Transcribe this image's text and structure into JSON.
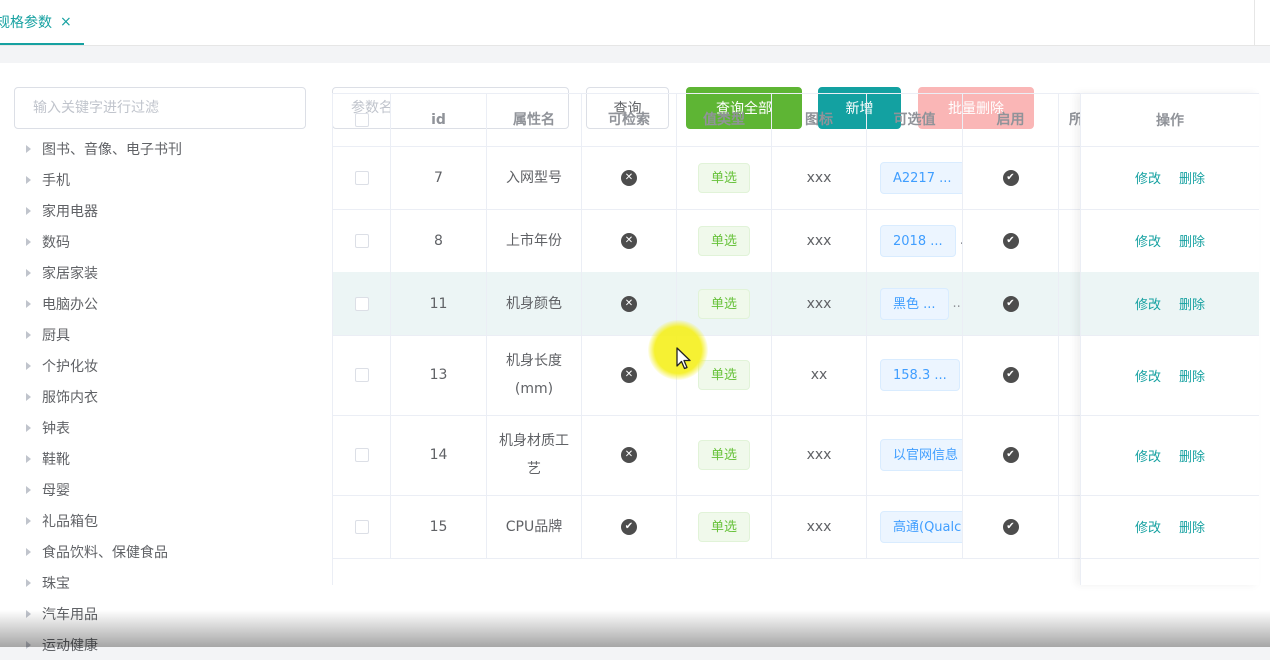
{
  "tabs": [
    {
      "label": "规格参数",
      "close": "×"
    }
  ],
  "sidebar": {
    "filter_placeholder": "输入关键字进行过滤",
    "categories": [
      "图书、音像、电子书刊",
      "手机",
      "家用电器",
      "数码",
      "家居家装",
      "电脑办公",
      "厨具",
      "个护化妆",
      "服饰内衣",
      "钟表",
      "鞋靴",
      "母婴",
      "礼品箱包",
      "食品饮料、保健食品",
      "珠宝",
      "汽车用品",
      "运动健康"
    ]
  },
  "toolbar": {
    "param_placeholder": "参数名",
    "query_label": "查询",
    "query_all_label": "查询全部",
    "add_label": "新增",
    "batch_delete_label": "批量删除"
  },
  "table": {
    "headers": {
      "id": "id",
      "name": "属性名",
      "searchable": "可检索",
      "value_type": "值类型",
      "icon": "图标",
      "options": "可选值",
      "enabled": "启用",
      "extra": "所",
      "actions": "操作"
    },
    "rows": [
      {
        "id": "7",
        "name": "入网型号",
        "searchable": false,
        "value_type": "单选",
        "icon": "xxx",
        "options": "A2217 ...",
        "more": "",
        "enabled": true,
        "edit": "修改",
        "delete": "删除"
      },
      {
        "id": "8",
        "name": "上市年份",
        "searchable": false,
        "value_type": "单选",
        "icon": "xxx",
        "options": "2018 ...",
        "more": "...",
        "enabled": true,
        "edit": "修改",
        "delete": "删除"
      },
      {
        "id": "11",
        "name": "机身颜色",
        "searchable": false,
        "value_type": "单选",
        "icon": "xxx",
        "options": "黑色 ...",
        "more": "...",
        "enabled": true,
        "edit": "修改",
        "delete": "删除"
      },
      {
        "id": "13",
        "name": "机身长度(mm)",
        "searchable": false,
        "value_type": "单选",
        "icon": "xx",
        "options": "158.3 ...",
        "more": "...",
        "enabled": true,
        "edit": "修改",
        "delete": "删除"
      },
      {
        "id": "14",
        "name": "机身材质工艺",
        "searchable": false,
        "value_type": "单选",
        "icon": "xxx",
        "options": "以官网信息",
        "more": "",
        "enabled": true,
        "edit": "修改",
        "delete": "删除"
      },
      {
        "id": "15",
        "name": "CPU品牌",
        "searchable": true,
        "value_type": "单选",
        "icon": "xxx",
        "options": "高通(Qualc",
        "more": "",
        "enabled": true,
        "edit": "修改",
        "delete": "删除"
      }
    ]
  },
  "colors": {
    "accent": "#16a1a1",
    "success": "#5eb534",
    "danger_light": "#fab6b6",
    "highlight_row": "#ecf5f5"
  },
  "icons": {
    "searchable_false": "circle-x-icon",
    "searchable_true": "circle-check-icon",
    "enabled": "circle-check-icon",
    "tree": "caret-right-icon",
    "cursor": "mouse-pointer-icon"
  }
}
